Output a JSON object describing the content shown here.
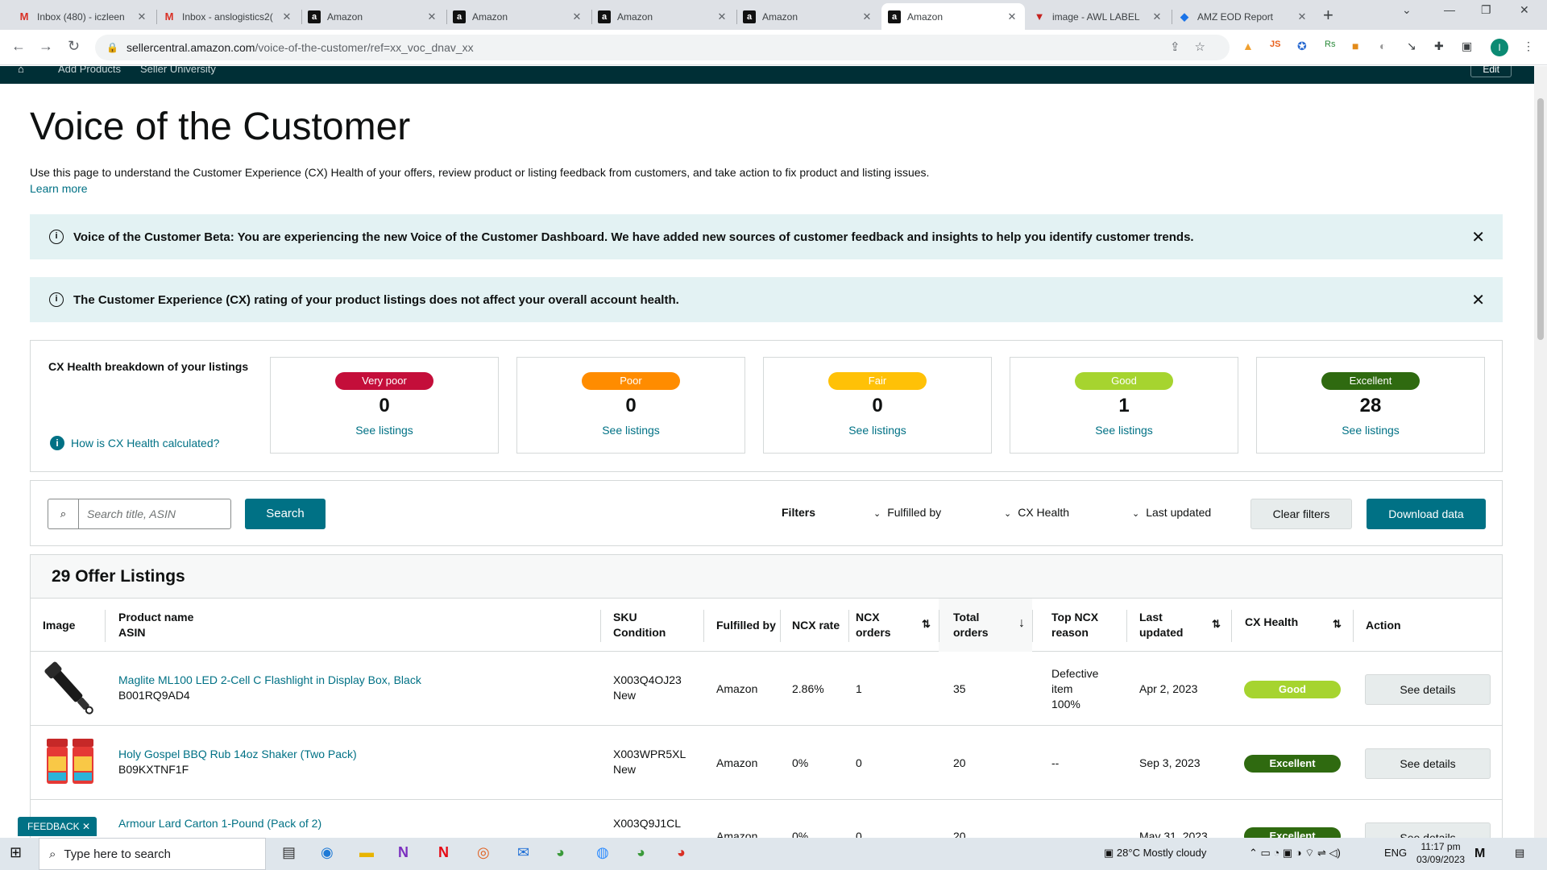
{
  "browser": {
    "tabs": [
      {
        "title": "Inbox (480) - iczleen",
        "icon": "gmail-icon"
      },
      {
        "title": "Inbox - anslogistics2(",
        "icon": "gmail-icon"
      },
      {
        "title": "Amazon",
        "icon": "amazon-icon"
      },
      {
        "title": "Amazon",
        "icon": "amazon-icon"
      },
      {
        "title": "Amazon",
        "icon": "amazon-icon"
      },
      {
        "title": "Amazon",
        "icon": "amazon-icon"
      },
      {
        "title": "Amazon",
        "icon": "amazon-icon"
      },
      {
        "title": "image - AWL LABEL",
        "icon": "label-icon"
      },
      {
        "title": "AMZ EOD Report",
        "icon": "report-icon"
      }
    ],
    "url_host": "sellercentral.amazon.com",
    "url_path": "/voice-of-the-customer/ref=xx_voc_dnav_xx",
    "profile_initial": "I"
  },
  "topnav": {
    "items": [
      "Add Products",
      "Seller University"
    ],
    "edit": "Edit"
  },
  "page": {
    "title": "Voice of the Customer",
    "intro": "Use this page to understand the Customer Experience (CX) Health of your offers, review product or listing feedback from customers, and take action to fix product and listing issues.",
    "learn_more": "Learn more"
  },
  "banners": [
    {
      "text": "Voice of the Customer Beta: You are experiencing the new Voice of the Customer Dashboard. We have added new sources of customer feedback and insights to help you identify customer trends."
    },
    {
      "text": "The Customer Experience (CX) rating of your product listings does not affect your overall account health."
    }
  ],
  "cx_health": {
    "title": "CX Health breakdown of your listings",
    "how_link": "How is CX Health calculated?",
    "cards": [
      {
        "label": "Very poor",
        "count": "0",
        "link": "See listings",
        "color": "#c40e3a",
        "text_color": "#ffffff"
      },
      {
        "label": "Poor",
        "count": "0",
        "link": "See listings",
        "color": "#ff8c00",
        "text_color": "#ffffff"
      },
      {
        "label": "Fair",
        "count": "0",
        "link": "See listings",
        "color": "#ffc107",
        "text_color": "#ffffff"
      },
      {
        "label": "Good",
        "count": "1",
        "link": "See listings",
        "color": "#a6d42f",
        "text_color": "#ffffff"
      },
      {
        "label": "Excellent",
        "count": "28",
        "link": "See listings",
        "color": "#2f6a10",
        "text_color": "#ffffff"
      }
    ]
  },
  "filters": {
    "search_placeholder": "Search title, ASIN",
    "search_button": "Search",
    "label": "Filters",
    "dropdowns": [
      "Fulfilled by",
      "CX Health",
      "Last updated"
    ],
    "clear": "Clear filters",
    "download": "Download data"
  },
  "listings": {
    "heading": "29 Offer Listings",
    "columns": {
      "image": "Image",
      "product_name": "Product name",
      "asin": "ASIN",
      "sku": "SKU",
      "condition": "Condition",
      "fulfilled_by": "Fulfilled by",
      "ncx_rate": "NCX rate",
      "ncx_orders_1": "NCX",
      "ncx_orders_2": "orders",
      "total_orders_1": "Total",
      "total_orders_2": "orders",
      "top_ncx_1": "Top NCX",
      "top_ncx_2": "reason",
      "last_updated_1": "Last",
      "last_updated_2": "updated",
      "cx_health": "CX Health",
      "action": "Action"
    },
    "rows": [
      {
        "name": "Maglite ML100 LED 2-Cell C Flashlight in Display Box, Black",
        "asin": "B001RQ9AD4",
        "sku": "X003Q4OJ23",
        "condition": "New",
        "fulfilled_by": "Amazon",
        "ncx_rate": "2.86%",
        "ncx_orders": "1",
        "total_orders": "35",
        "reason_1": "Defective",
        "reason_2": "item",
        "reason_3": "100%",
        "last_updated": "Apr 2, 2023",
        "health": "Good",
        "health_color": "#a6d42f",
        "action": "See details",
        "thumb": "flashlight"
      },
      {
        "name": "Holy Gospel BBQ Rub 14oz Shaker (Two Pack)",
        "asin": "B09KXTNF1F",
        "sku": "X003WPR5XL",
        "condition": "New",
        "fulfilled_by": "Amazon",
        "ncx_rate": "0%",
        "ncx_orders": "0",
        "total_orders": "20",
        "reason_1": "--",
        "reason_2": "",
        "reason_3": "",
        "last_updated": "Sep 3, 2023",
        "health": "Excellent",
        "health_color": "#2f6a10",
        "action": "See details",
        "thumb": "shakers"
      },
      {
        "name": "Armour Lard Carton 1-Pound (Pack of 2)",
        "asin": "",
        "sku": "X003Q9J1CL",
        "condition": "",
        "fulfilled_by": "Amazon",
        "ncx_rate": "0%",
        "ncx_orders": "0",
        "total_orders": "20",
        "reason_1": "",
        "reason_2": "",
        "reason_3": "",
        "last_updated": "May 31, 2023",
        "health": "Excellent",
        "health_color": "#2f6a10",
        "action": "See details",
        "thumb": ""
      }
    ]
  },
  "feedback": "FEEDBACK",
  "taskbar": {
    "search_placeholder": "Type here to search",
    "weather": "28°C  Mostly cloudy",
    "lang": "ENG",
    "time": "11:17 pm",
    "date": "03/09/2023"
  }
}
